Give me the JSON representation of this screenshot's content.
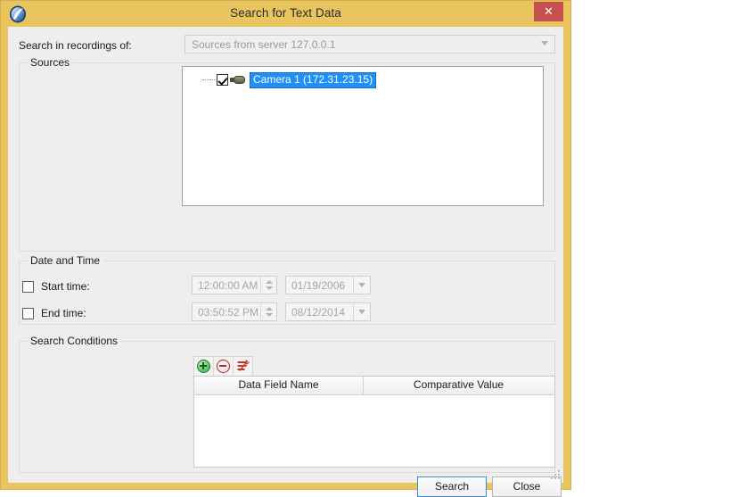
{
  "window": {
    "title": "Search for Text Data",
    "app_icon": "app-shield-icon",
    "close_label": "✕",
    "frame_color": "#eac55f",
    "close_color": "#c4504f",
    "client_bg": "#efeeee"
  },
  "top": {
    "search_in_label": "Search in recordings of:",
    "sources_combo_value": "Sources from server 127.0.0.1",
    "sources_combo_enabled": false
  },
  "sources_group": {
    "title": "Sources",
    "tree": {
      "items": [
        {
          "label": "Camera 1 (172.31.23.15)",
          "checked": true,
          "selected": true,
          "icon": "camera-icon",
          "selection_color": "#1e90f7"
        }
      ]
    }
  },
  "datetime_group": {
    "title": "Date and Time",
    "rows": [
      {
        "checkbox_label": "Start time:",
        "checked": false,
        "time_value": "12:00:00 AM",
        "date_value": "01/19/2006",
        "enabled": false
      },
      {
        "checkbox_label": "End time:",
        "checked": false,
        "time_value": "03:50:52 PM",
        "date_value": "08/12/2014",
        "enabled": false
      }
    ]
  },
  "conditions_group": {
    "title": "Search Conditions",
    "toolbar": [
      {
        "name": "add-condition-button",
        "icon": "plus-circle-icon",
        "color": "#5fbd63"
      },
      {
        "name": "remove-condition-button",
        "icon": "minus-circle-icon",
        "color": "#b32a2a"
      },
      {
        "name": "clear-conditions-button",
        "icon": "clear-list-icon",
        "color": "#c0392b"
      }
    ],
    "table": {
      "columns": [
        "Data Field Name",
        "Comparative Value"
      ],
      "rows": []
    }
  },
  "footer": {
    "search_label": "Search",
    "close_label": "Close",
    "default_button": "Search",
    "focus_color": "#3c8bd0"
  }
}
